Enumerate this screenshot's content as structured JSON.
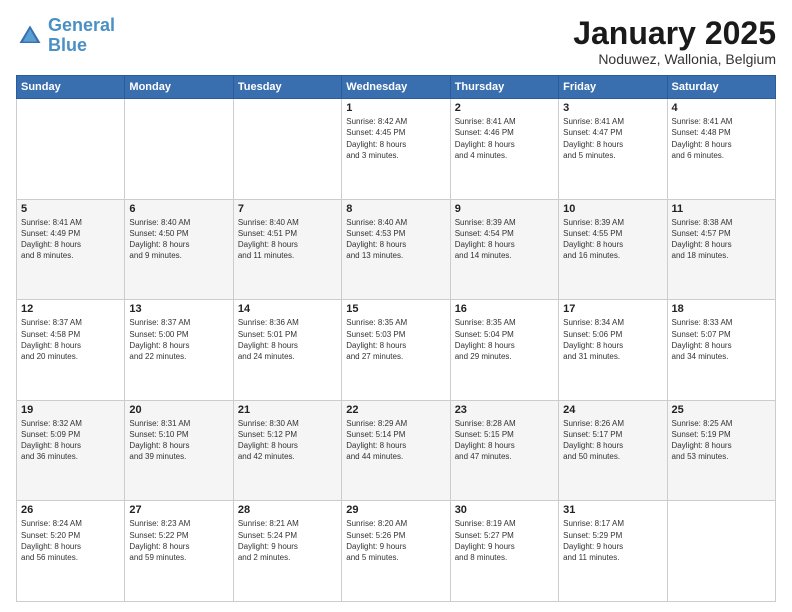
{
  "logo": {
    "line1": "General",
    "line2": "Blue"
  },
  "title": "January 2025",
  "subtitle": "Noduwez, Wallonia, Belgium",
  "days_of_week": [
    "Sunday",
    "Monday",
    "Tuesday",
    "Wednesday",
    "Thursday",
    "Friday",
    "Saturday"
  ],
  "weeks": [
    [
      {
        "day": "",
        "info": ""
      },
      {
        "day": "",
        "info": ""
      },
      {
        "day": "",
        "info": ""
      },
      {
        "day": "1",
        "info": "Sunrise: 8:42 AM\nSunset: 4:45 PM\nDaylight: 8 hours\nand 3 minutes."
      },
      {
        "day": "2",
        "info": "Sunrise: 8:41 AM\nSunset: 4:46 PM\nDaylight: 8 hours\nand 4 minutes."
      },
      {
        "day": "3",
        "info": "Sunrise: 8:41 AM\nSunset: 4:47 PM\nDaylight: 8 hours\nand 5 minutes."
      },
      {
        "day": "4",
        "info": "Sunrise: 8:41 AM\nSunset: 4:48 PM\nDaylight: 8 hours\nand 6 minutes."
      }
    ],
    [
      {
        "day": "5",
        "info": "Sunrise: 8:41 AM\nSunset: 4:49 PM\nDaylight: 8 hours\nand 8 minutes."
      },
      {
        "day": "6",
        "info": "Sunrise: 8:40 AM\nSunset: 4:50 PM\nDaylight: 8 hours\nand 9 minutes."
      },
      {
        "day": "7",
        "info": "Sunrise: 8:40 AM\nSunset: 4:51 PM\nDaylight: 8 hours\nand 11 minutes."
      },
      {
        "day": "8",
        "info": "Sunrise: 8:40 AM\nSunset: 4:53 PM\nDaylight: 8 hours\nand 13 minutes."
      },
      {
        "day": "9",
        "info": "Sunrise: 8:39 AM\nSunset: 4:54 PM\nDaylight: 8 hours\nand 14 minutes."
      },
      {
        "day": "10",
        "info": "Sunrise: 8:39 AM\nSunset: 4:55 PM\nDaylight: 8 hours\nand 16 minutes."
      },
      {
        "day": "11",
        "info": "Sunrise: 8:38 AM\nSunset: 4:57 PM\nDaylight: 8 hours\nand 18 minutes."
      }
    ],
    [
      {
        "day": "12",
        "info": "Sunrise: 8:37 AM\nSunset: 4:58 PM\nDaylight: 8 hours\nand 20 minutes."
      },
      {
        "day": "13",
        "info": "Sunrise: 8:37 AM\nSunset: 5:00 PM\nDaylight: 8 hours\nand 22 minutes."
      },
      {
        "day": "14",
        "info": "Sunrise: 8:36 AM\nSunset: 5:01 PM\nDaylight: 8 hours\nand 24 minutes."
      },
      {
        "day": "15",
        "info": "Sunrise: 8:35 AM\nSunset: 5:03 PM\nDaylight: 8 hours\nand 27 minutes."
      },
      {
        "day": "16",
        "info": "Sunrise: 8:35 AM\nSunset: 5:04 PM\nDaylight: 8 hours\nand 29 minutes."
      },
      {
        "day": "17",
        "info": "Sunrise: 8:34 AM\nSunset: 5:06 PM\nDaylight: 8 hours\nand 31 minutes."
      },
      {
        "day": "18",
        "info": "Sunrise: 8:33 AM\nSunset: 5:07 PM\nDaylight: 8 hours\nand 34 minutes."
      }
    ],
    [
      {
        "day": "19",
        "info": "Sunrise: 8:32 AM\nSunset: 5:09 PM\nDaylight: 8 hours\nand 36 minutes."
      },
      {
        "day": "20",
        "info": "Sunrise: 8:31 AM\nSunset: 5:10 PM\nDaylight: 8 hours\nand 39 minutes."
      },
      {
        "day": "21",
        "info": "Sunrise: 8:30 AM\nSunset: 5:12 PM\nDaylight: 8 hours\nand 42 minutes."
      },
      {
        "day": "22",
        "info": "Sunrise: 8:29 AM\nSunset: 5:14 PM\nDaylight: 8 hours\nand 44 minutes."
      },
      {
        "day": "23",
        "info": "Sunrise: 8:28 AM\nSunset: 5:15 PM\nDaylight: 8 hours\nand 47 minutes."
      },
      {
        "day": "24",
        "info": "Sunrise: 8:26 AM\nSunset: 5:17 PM\nDaylight: 8 hours\nand 50 minutes."
      },
      {
        "day": "25",
        "info": "Sunrise: 8:25 AM\nSunset: 5:19 PM\nDaylight: 8 hours\nand 53 minutes."
      }
    ],
    [
      {
        "day": "26",
        "info": "Sunrise: 8:24 AM\nSunset: 5:20 PM\nDaylight: 8 hours\nand 56 minutes."
      },
      {
        "day": "27",
        "info": "Sunrise: 8:23 AM\nSunset: 5:22 PM\nDaylight: 8 hours\nand 59 minutes."
      },
      {
        "day": "28",
        "info": "Sunrise: 8:21 AM\nSunset: 5:24 PM\nDaylight: 9 hours\nand 2 minutes."
      },
      {
        "day": "29",
        "info": "Sunrise: 8:20 AM\nSunset: 5:26 PM\nDaylight: 9 hours\nand 5 minutes."
      },
      {
        "day": "30",
        "info": "Sunrise: 8:19 AM\nSunset: 5:27 PM\nDaylight: 9 hours\nand 8 minutes."
      },
      {
        "day": "31",
        "info": "Sunrise: 8:17 AM\nSunset: 5:29 PM\nDaylight: 9 hours\nand 11 minutes."
      },
      {
        "day": "",
        "info": ""
      }
    ]
  ]
}
